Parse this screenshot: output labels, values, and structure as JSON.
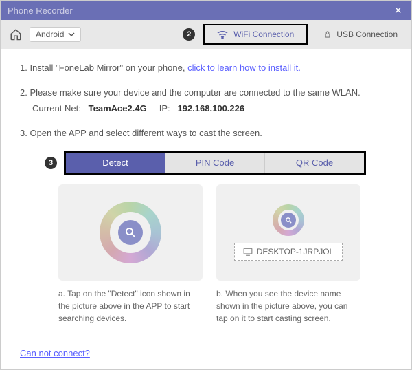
{
  "window": {
    "title": "Phone Recorder"
  },
  "toolbar": {
    "platform": "Android",
    "step_badge": "2",
    "wifi_label": "WiFi Connection",
    "usb_label": "USB Connection"
  },
  "steps": {
    "s1_prefix": "1. Install \"FoneLab Mirror\" on your phone, ",
    "s1_link": "click to learn how to install it.",
    "s2": "2. Please make sure your device and the computer are connected to the same WLAN.",
    "net_label": "Current Net:",
    "net_value": "TeamAce2.4G",
    "ip_label": "IP:",
    "ip_value": "192.168.100.226",
    "s3": "3. Open the APP and select different ways to cast the screen."
  },
  "tabs": {
    "step_badge": "3",
    "items": [
      "Detect",
      "PIN Code",
      "QR Code"
    ],
    "active": 0
  },
  "cards": {
    "device_name": "DESKTOP-1JRPJOL",
    "caption_a": "a. Tap on the \"Detect\" icon shown in the picture above in the APP to start searching devices.",
    "caption_b": "b. When you see the device name shown in the picture above, you can tap on it to start casting screen."
  },
  "footer": {
    "cannot_connect": "Can not connect?"
  }
}
